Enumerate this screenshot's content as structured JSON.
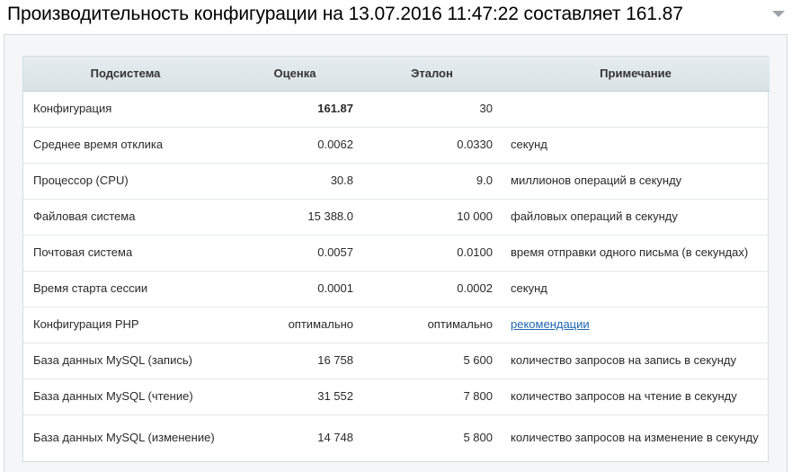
{
  "header": {
    "title": "Производительность конфигурации на 13.07.2016 11:47:22 составляет 161.87"
  },
  "table": {
    "columns": [
      "Подсистема",
      "Оценка",
      "Эталон",
      "Примечание"
    ],
    "rows": [
      {
        "subsystem": "Конфигурация",
        "score": "161.87",
        "reference": "30",
        "note": ""
      },
      {
        "subsystem": "Среднее время отклика",
        "score": "0.0062",
        "reference": "0.0330",
        "note": "секунд"
      },
      {
        "subsystem": "Процессор (CPU)",
        "score": "30.8",
        "reference": "9.0",
        "note": "миллионов операций в секунду"
      },
      {
        "subsystem": "Файловая система",
        "score": "15 388.0",
        "reference": "10 000",
        "note": "файловых операций в секунду"
      },
      {
        "subsystem": "Почтовая система",
        "score": "0.0057",
        "reference": "0.0100",
        "note": "время отправки одного письма (в секундах)"
      },
      {
        "subsystem": "Время старта сессии",
        "score": "0.0001",
        "reference": "0.0002",
        "note": "секунд"
      },
      {
        "subsystem": "Конфигурация PHP",
        "score": "оптимально",
        "reference": "оптимально",
        "note": "рекомендации"
      },
      {
        "subsystem": "База данных MySQL (запись)",
        "score": "16 758",
        "reference": "5 600",
        "note": "количество запросов на запись в секунду"
      },
      {
        "subsystem": "База данных MySQL (чтение)",
        "score": "31 552",
        "reference": "7 800",
        "note": "количество запросов на чтение в секунду"
      },
      {
        "subsystem": "База данных MySQL (изменение)",
        "score": "14 748",
        "reference": "5 800",
        "note": "количество запросов на изменение в секунду"
      }
    ]
  },
  "icons": {
    "collapse": "chevron-down-icon"
  },
  "colors": {
    "link": "#2067b0",
    "header_bg": "#dfe6e9",
    "panel_bg": "#f4f6f7"
  }
}
